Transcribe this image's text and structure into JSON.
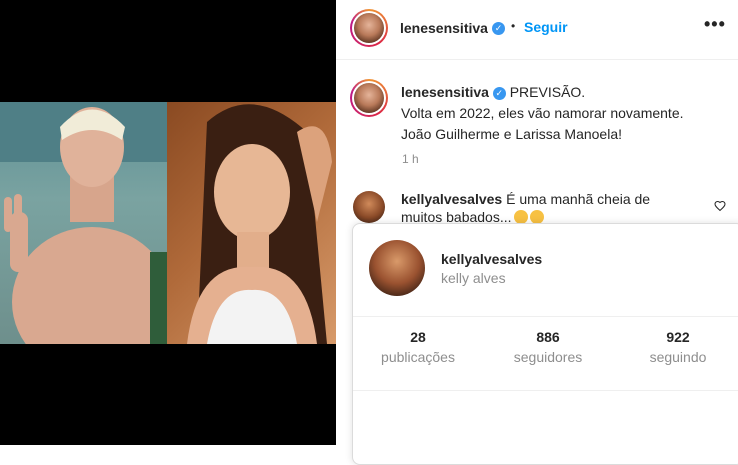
{
  "header": {
    "username": "lenesensitiva",
    "separator": "•",
    "follow_label": "Seguir",
    "more_icon": "more-horizontal-icon"
  },
  "caption": {
    "username": "lenesensitiva",
    "line1": "PREVISÃO.",
    "line2": "Volta em 2022, eles vão namorar novamente.",
    "line3": "João Guilherme e Larissa Manoela!",
    "time": "1 h"
  },
  "comment": {
    "username": "kellyalvesalves",
    "text_line1": "É uma manhã cheia de",
    "text_line2": "muitos babados...",
    "like_icon": "heart-icon"
  },
  "profile_card": {
    "username": "kellyalvesalves",
    "full_name": "kelly alves",
    "stats": [
      {
        "value": "28",
        "label": "publicações"
      },
      {
        "value": "886",
        "label": "seguidores"
      },
      {
        "value": "922",
        "label": "seguindo"
      }
    ]
  }
}
